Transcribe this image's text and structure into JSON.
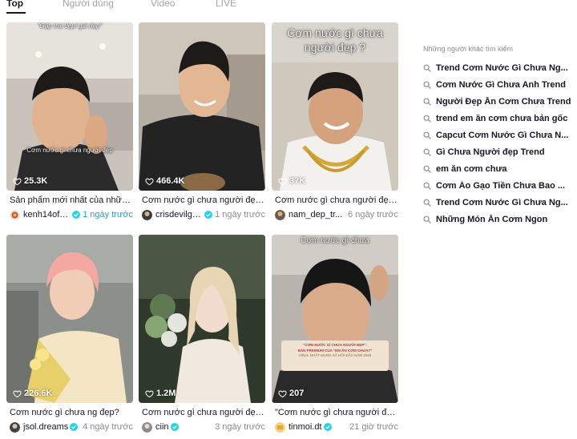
{
  "tabs": [
    {
      "label": "Top",
      "active": true
    },
    {
      "label": "Người dùng",
      "active": false
    },
    {
      "label": "Video",
      "active": false
    },
    {
      "label": "LIVE",
      "active": false
    }
  ],
  "videos": [
    {
      "overlay_top": "\"Gặp trai đẹp/ gái đẹp\"",
      "overlay_caption": "Cơm nước gì chưa người đẹp",
      "views": "25.3K",
      "description": "Sản phẩm mới nhất của những...",
      "username": "kenh14offic...",
      "verified": true,
      "time": "1 ngày trước",
      "time_color": "#25a0cf"
    },
    {
      "views": "466.4K",
      "description": "Cơm nước gì chưa người đẹp...",
      "username": "crisdevilga...",
      "verified": true,
      "time": "1 ngày trước"
    },
    {
      "overlay_top": "Cơm nước gì chưa người đẹp ?",
      "views": "37K",
      "description": "Cơm nước gì chưa người đẹp...",
      "username": "nam_dep_tr...",
      "verified": false,
      "time": "6 ngày trước"
    },
    {
      "views": "226.6K",
      "description": "Cơm nước gì chưa ng đẹp?",
      "username": "jsol.dreams",
      "verified": true,
      "time": "4 ngày trước"
    },
    {
      "views": "1.2M",
      "description": "Cơm nước gì chưa người đẹp...",
      "username": "ciin",
      "verified": true,
      "time": "3 ngày trước"
    },
    {
      "overlay_top": "Cơm nước gì chưa",
      "promo": {
        "line1": "\"CƠM NƯỚC GÌ CHƯA NGƯỜI ĐẸP\":",
        "line2": "BẢN PREMIUM CỦA \"EM ĂN CƠM CHƯA?\"",
        "line3": "VIRAL NHẤT MẠNG XÃ HỘI ĐẦU NĂM 2025"
      },
      "views": "207",
      "description": "\"Cơm nước gì chưa người đẹp...",
      "username": "tinmoi.dt",
      "verified": true,
      "time": "21 giờ trước"
    }
  ],
  "sidebar": {
    "title": "Những người khác tìm kiếm",
    "suggestions": [
      "Trend Cơm Nước Gì Chưa Ng...",
      "Cơm Nước Gì Chưa Anh Trend",
      "Người Đẹp Ăn Cơm Chưa Trend",
      "trend em ăn cơm chưa bản gốc",
      "Capcut Cơm Nước Gì Chưa N...",
      "Gì Chưa Người đẹp Trend",
      "em ăn cơm chưa",
      "Cơm Áo Gạo Tiền Chưa Bao ...",
      "Trend Cơm Nước Gì Chưa Ng...",
      "Những Món Ăn Cơm Ngon"
    ]
  },
  "colors": {
    "text": "#161823",
    "muted": "#8a8b91",
    "verified": "#20d5ec"
  },
  "icons": [
    "heart-outline-icon",
    "verified-badge-icon",
    "search-icon"
  ]
}
